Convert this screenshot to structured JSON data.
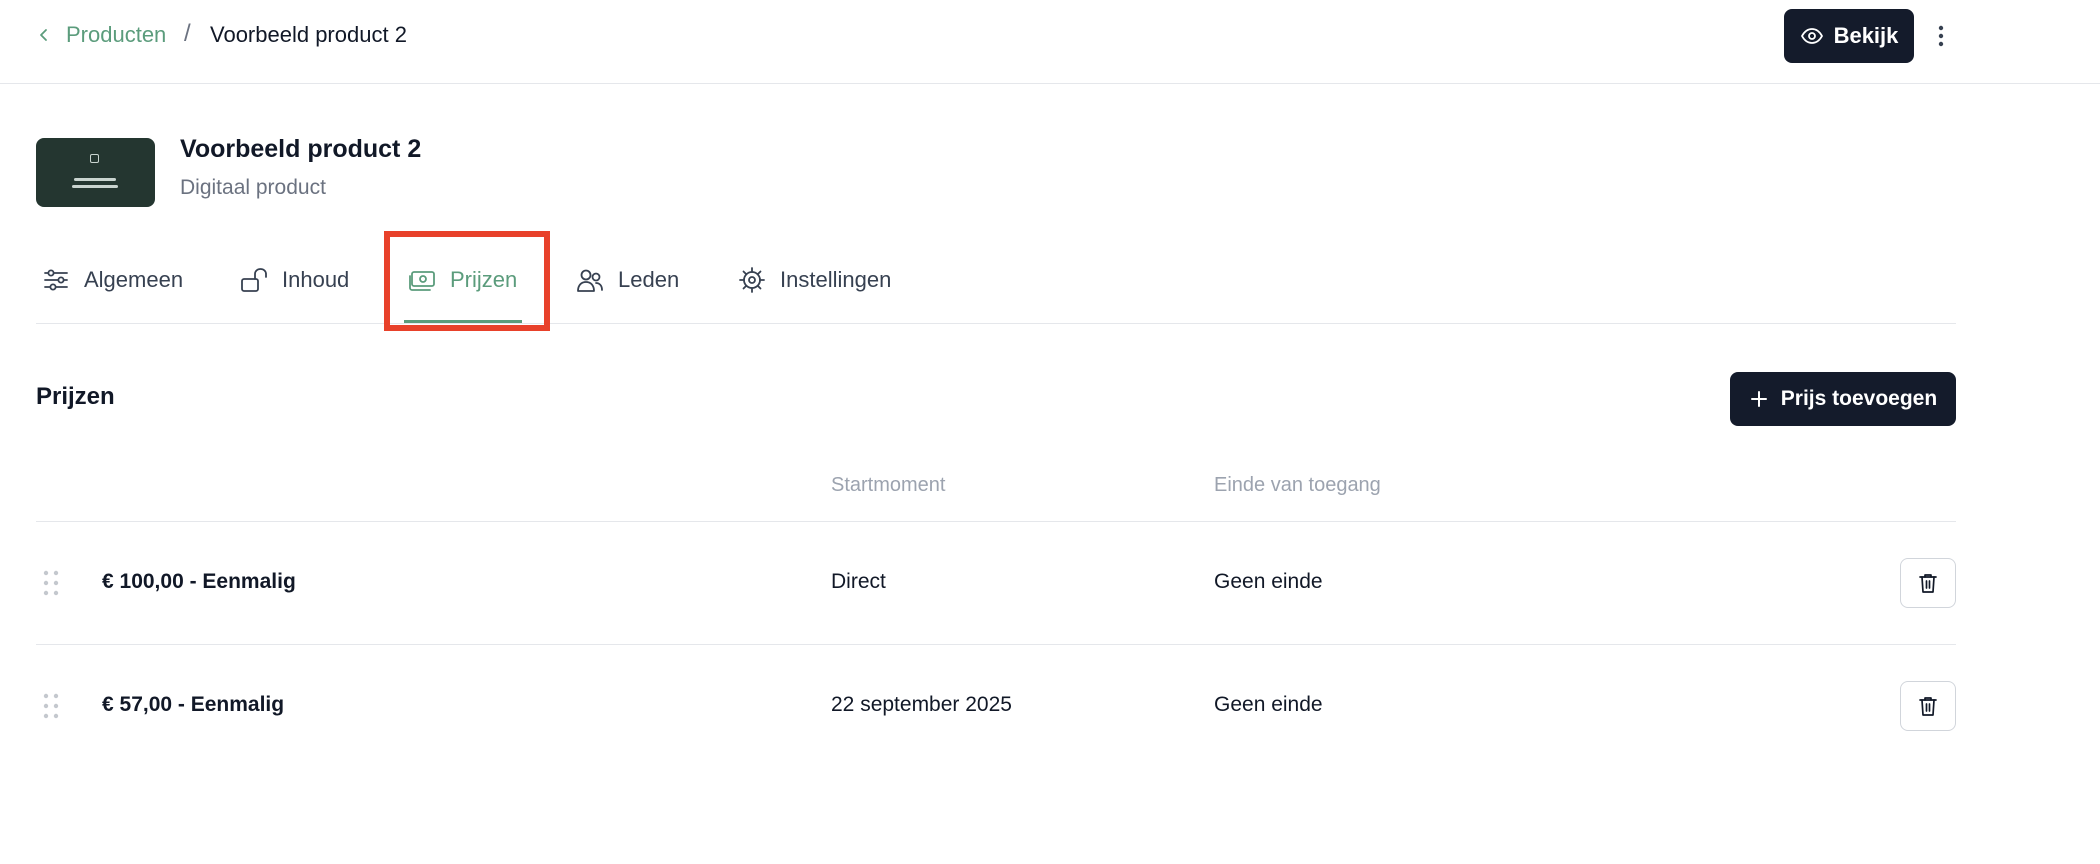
{
  "breadcrumb": {
    "back_label": "Producten",
    "separator": "/",
    "current": "Voorbeeld product 2"
  },
  "header_actions": {
    "view_label": "Bekijk",
    "view_icon": "eye-icon",
    "more_icon": "more-vertical-icon"
  },
  "product": {
    "title": "Voorbeeld product 2",
    "subtitle": "Digitaal product"
  },
  "tabs": [
    {
      "label": "Algemeen",
      "icon": "sliders-icon",
      "active": false
    },
    {
      "label": "Inhoud",
      "icon": "unlock-icon",
      "active": false
    },
    {
      "label": "Prijzen",
      "icon": "banknote-icon",
      "active": true
    },
    {
      "label": "Leden",
      "icon": "users-icon",
      "active": false
    },
    {
      "label": "Instellingen",
      "icon": "gear-icon",
      "active": false
    }
  ],
  "prices": {
    "title": "Prijzen",
    "add_label": "Prijs toevoegen",
    "columns": [
      "",
      "Startmoment",
      "Einde van toegang"
    ],
    "rows": [
      {
        "price": "€ 100,00 - Eenmalig",
        "start": "Direct",
        "end": "Geen einde"
      },
      {
        "price": "€ 57,00 - Eenmalig",
        "start": "22 september 2025",
        "end": "Geen einde"
      }
    ]
  },
  "colors": {
    "accent": "#5b9c7c",
    "button_dark": "#141b2b",
    "highlight": "#e8412a"
  }
}
